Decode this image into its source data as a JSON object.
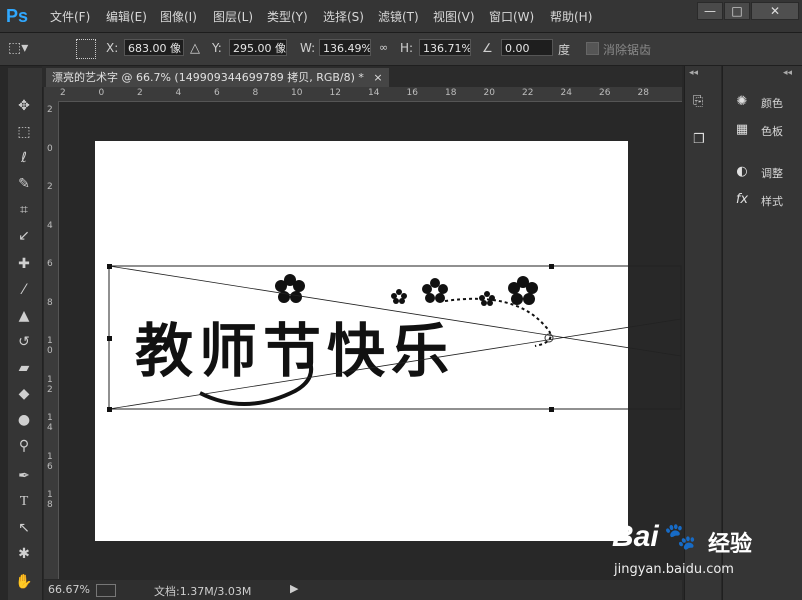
{
  "app": {
    "logo": "Ps"
  },
  "menu": [
    {
      "label": "文件(F)"
    },
    {
      "label": "编辑(E)"
    },
    {
      "label": "图像(I)"
    },
    {
      "label": "图层(L)"
    },
    {
      "label": "类型(Y)"
    },
    {
      "label": "选择(S)"
    },
    {
      "label": "滤镜(T)"
    },
    {
      "label": "视图(V)"
    },
    {
      "label": "窗口(W)"
    },
    {
      "label": "帮助(H)"
    }
  ],
  "window_controls": {
    "minimize": "—",
    "maximize": "□",
    "close": "✕"
  },
  "options": {
    "x_label": "X:",
    "x_value": "683.00 像",
    "y_label": "Y:",
    "y_value": "295.00 像",
    "w_label": "W:",
    "w_value": "136.49%",
    "h_label": "H:",
    "h_value": "136.71%",
    "angle_value": "0.00",
    "angle_unit": "度",
    "antialias_label": "消除锯齿"
  },
  "document": {
    "tab_title": "漂亮的艺术字 @ 66.7% (149909344699789 拷贝, RGB/8) *",
    "tab_close": "×",
    "ruler_h": [
      "2",
      "0",
      "2",
      "4",
      "6",
      "8",
      "10",
      "12",
      "14",
      "16",
      "18",
      "20",
      "22",
      "24",
      "26",
      "28"
    ],
    "ruler_v": [
      "2",
      "0",
      "2",
      "4",
      "6",
      "8",
      "1\n0",
      "1\n2",
      "1\n4",
      "1\n6",
      "1\n8"
    ],
    "art_text": "教师节快乐"
  },
  "status": {
    "zoom": "66.67%",
    "doc_info": "文档:1.37M/3.03M"
  },
  "panels": {
    "items": [
      {
        "label": "颜色",
        "icon": "palette-icon"
      },
      {
        "label": "色板",
        "icon": "swatches-icon"
      },
      {
        "label": "调整",
        "icon": "adjustments-icon"
      },
      {
        "label": "样式",
        "icon": "styles-icon"
      }
    ]
  },
  "watermark": {
    "brand": "Bai",
    "brand2": "经验",
    "url": "jingyan.baidu.com"
  },
  "colors": {
    "accent": "#30a8ff",
    "bg": "#282828",
    "panel": "#353535"
  }
}
